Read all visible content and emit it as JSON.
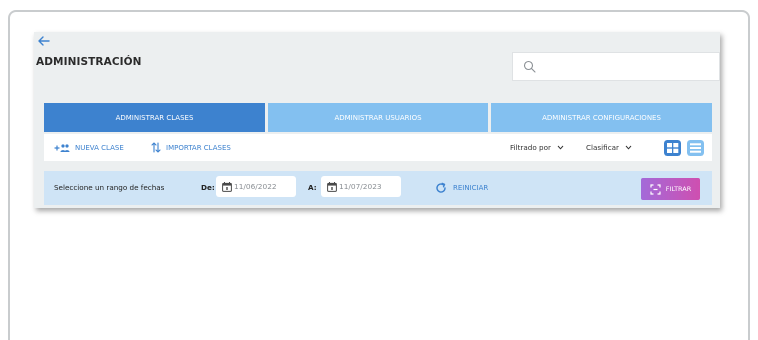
{
  "header": {
    "title": "ADMINISTRACIÓN",
    "search_placeholder": ""
  },
  "tabs": [
    {
      "label": "ADMINISTRAR CLASES",
      "active": true
    },
    {
      "label": "ADMINISTRAR USUARIOS",
      "active": false
    },
    {
      "label": "ADMINISTRAR CONFIGURACIONES",
      "active": false
    }
  ],
  "toolbar": {
    "new_class_label": "NUEVA CLASE",
    "import_classes_label": "IMPORTAR CLASES",
    "filter_by_label": "Filtrado por",
    "sort_label": "Clasificar"
  },
  "date_range": {
    "prompt": "Seleccione un rango de fechas",
    "from_label": "De:",
    "from_value": "11/06/2022",
    "to_label": "A:",
    "to_value": "11/07/2023",
    "reset_label": "REINICIAR",
    "filter_label": "FILTRAR"
  },
  "colors": {
    "accent": "#3d82cf",
    "tab_inactive": "#83c0f0",
    "date_bar": "#cfe4f6",
    "filter_gradient_start": "#a36ad9",
    "filter_gradient_end": "#cf4fb0"
  },
  "icons": {
    "back": "arrow-left-icon",
    "search": "search-icon",
    "new_class": "add-group-icon",
    "import": "import-arrows-icon",
    "grid_view": "grid-view-icon",
    "list_view": "list-view-icon",
    "calendar": "calendar-icon",
    "reset": "refresh-icon",
    "filter": "filter-icon"
  }
}
